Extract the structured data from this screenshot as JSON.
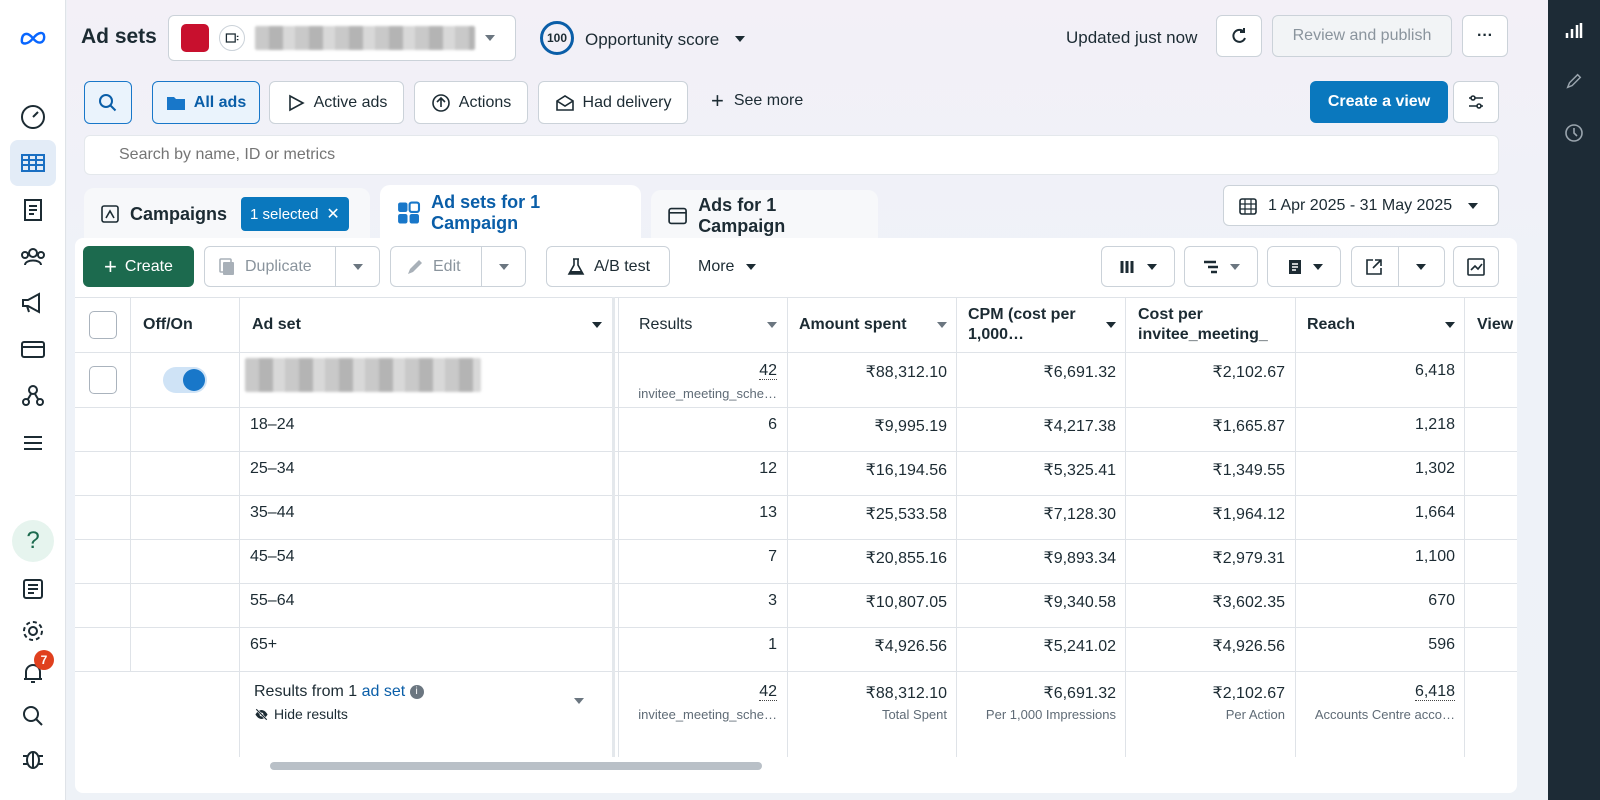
{
  "header": {
    "title": "Ad sets",
    "opportunity_score": "100",
    "opportunity_label": "Opportunity score",
    "updated_text": "Updated just now",
    "review_publish": "Review and publish",
    "more": "···"
  },
  "filters": {
    "all_ads": "All ads",
    "active_ads": "Active ads",
    "actions": "Actions",
    "had_delivery": "Had delivery",
    "see_more": "See more",
    "create_view": "Create a view",
    "search_placeholder": "Search by name, ID or metrics"
  },
  "tabs": {
    "campaigns": "Campaigns",
    "selected_chip": "1 selected",
    "adsets": "Ad sets for 1 Campaign",
    "ads": "Ads for 1 Campaign",
    "date_range": "1 Apr 2025 - 31 May 2025"
  },
  "toolbar": {
    "create": "Create",
    "duplicate": "Duplicate",
    "edit": "Edit",
    "ab_test": "A/B test",
    "more": "More"
  },
  "columns": {
    "offon": "Off/On",
    "adset": "Ad set",
    "results": "Results",
    "amount": "Amount spent",
    "cpm": "CPM (cost per 1,000…",
    "cost": "Cost per invitee_meeting_",
    "reach": "Reach",
    "views": "View"
  },
  "main_row": {
    "results": "42",
    "results_sub": "invitee_meeting_sche…",
    "amount": "₹88,312.10",
    "cpm": "₹6,691.32",
    "cost": "₹2,102.67",
    "reach": "6,418"
  },
  "rows": [
    {
      "label": "18–24",
      "results": "6",
      "amount": "₹9,995.19",
      "cpm": "₹4,217.38",
      "cost": "₹1,665.87",
      "reach": "1,218"
    },
    {
      "label": "25–34",
      "results": "12",
      "amount": "₹16,194.56",
      "cpm": "₹5,325.41",
      "cost": "₹1,349.55",
      "reach": "1,302"
    },
    {
      "label": "35–44",
      "results": "13",
      "amount": "₹25,533.58",
      "cpm": "₹7,128.30",
      "cost": "₹1,964.12",
      "reach": "1,664"
    },
    {
      "label": "45–54",
      "results": "7",
      "amount": "₹20,855.16",
      "cpm": "₹9,893.34",
      "cost": "₹2,979.31",
      "reach": "1,100"
    },
    {
      "label": "55–64",
      "results": "3",
      "amount": "₹10,807.05",
      "cpm": "₹9,340.58",
      "cost": "₹3,602.35",
      "reach": "670"
    },
    {
      "label": "65+",
      "results": "1",
      "amount": "₹4,926.56",
      "cpm": "₹5,241.02",
      "cost": "₹4,926.56",
      "reach": "596"
    }
  ],
  "summary": {
    "results_from": "Results from 1",
    "adset_link": "ad set",
    "hide_results": "Hide results",
    "results": "42",
    "results_sub": "invitee_meeting_sche…",
    "amount": "₹88,312.10",
    "amount_sub": "Total Spent",
    "cpm": "₹6,691.32",
    "cpm_sub": "Per 1,000 Impressions",
    "cost": "₹2,102.67",
    "cost_sub": "Per Action",
    "reach": "6,418",
    "reach_sub": "Accounts Centre acco…"
  },
  "notifications": {
    "count": "7"
  },
  "colors": {
    "accent": "#0a78be",
    "create_green": "#1c6a4e",
    "badge": "#e0401e"
  }
}
